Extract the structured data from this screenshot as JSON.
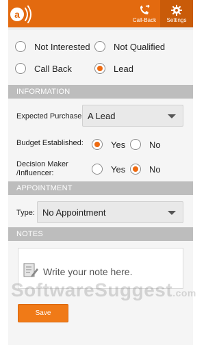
{
  "topbar": {
    "callback_label": "Call-Back",
    "settings_label": "Settings",
    "brand_color": "#e36a0f"
  },
  "status": {
    "options": [
      {
        "label": "Not Interested",
        "selected": false
      },
      {
        "label": "Not Qualified",
        "selected": false
      },
      {
        "label": "Call Back",
        "selected": false
      },
      {
        "label": "Lead",
        "selected": true
      }
    ]
  },
  "information": {
    "header": "INFORMATION",
    "expected_purchase_label": "Expected Purchase:",
    "expected_purchase_value": "A Lead",
    "budget_label": "Budget Established:",
    "decision_label_line1": "Decision Maker",
    "decision_label_line2": "/Influencer:",
    "yes_label": "Yes",
    "no_label": "No",
    "budget_selected": "Yes",
    "decision_selected": "No"
  },
  "appointment": {
    "header": "APPOINTMENT",
    "type_label": "Type:",
    "type_value": "No Appointment"
  },
  "notes": {
    "header": "NOTES",
    "placeholder": "Write your note here."
  },
  "actions": {
    "save_label": "Save"
  },
  "watermark": {
    "text": "SoftwareSuggest",
    "suffix": ".com"
  },
  "icons": [
    "logo-icon",
    "callback-icon",
    "gear-icon",
    "caret-down-icon",
    "note-icon"
  ]
}
